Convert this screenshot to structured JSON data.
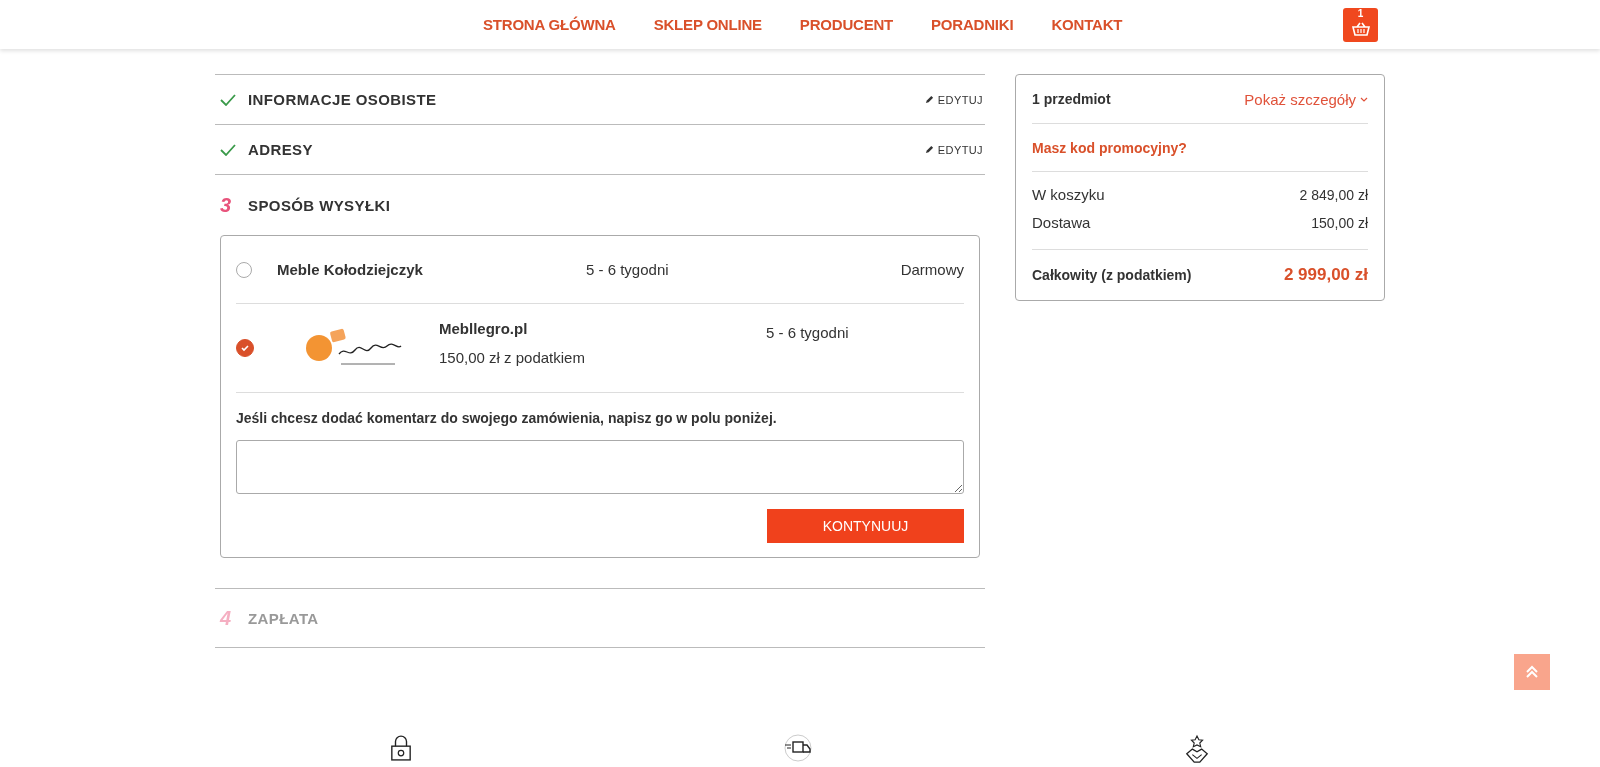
{
  "nav": {
    "items": [
      "STRONA GŁÓWNA",
      "SKLEP ONLINE",
      "PRODUCENT",
      "PORADNIKI",
      "KONTAKT"
    ],
    "cart_count": "1"
  },
  "steps": [
    {
      "kind": "done",
      "title": "INFORMACJE OSOBISTE",
      "edit": "EDYTUJ"
    },
    {
      "kind": "done",
      "title": "ADRESY",
      "edit": "EDYTUJ"
    },
    {
      "kind": "current",
      "number": "3",
      "title": "SPOSÓB WYSYŁKI"
    },
    {
      "kind": "pending",
      "number": "4",
      "title": "ZAPŁATA"
    }
  ],
  "carriers": [
    {
      "kind": "plain",
      "name": "Meble Kołodziejczyk",
      "delay": "5 - 6 tygodni",
      "price": "Darmowy",
      "selected": false
    },
    {
      "kind": "with-logo",
      "name": "Mebllegro.pl",
      "delay": "5 - 6 tygodni",
      "price": "150,00 zł z podatkiem",
      "selected": true
    }
  ],
  "comment_label": "Jeśli chcesz dodać komentarz do swojego zamówienia, napisz go w polu poniżej.",
  "continue_button": "KONTYNUUJ",
  "summary": {
    "items": "1 przedmiot",
    "details_link": "Pokaż szczegóły",
    "promo": "Masz kod promocyjny?",
    "lines": [
      {
        "label": "W koszyku",
        "value": "2 849,00 zł"
      },
      {
        "label": "Dostawa",
        "value": "150,00 zł"
      }
    ],
    "total": {
      "label": "Całkowity (z podatkiem)",
      "value": "2 999,00 zł"
    }
  }
}
